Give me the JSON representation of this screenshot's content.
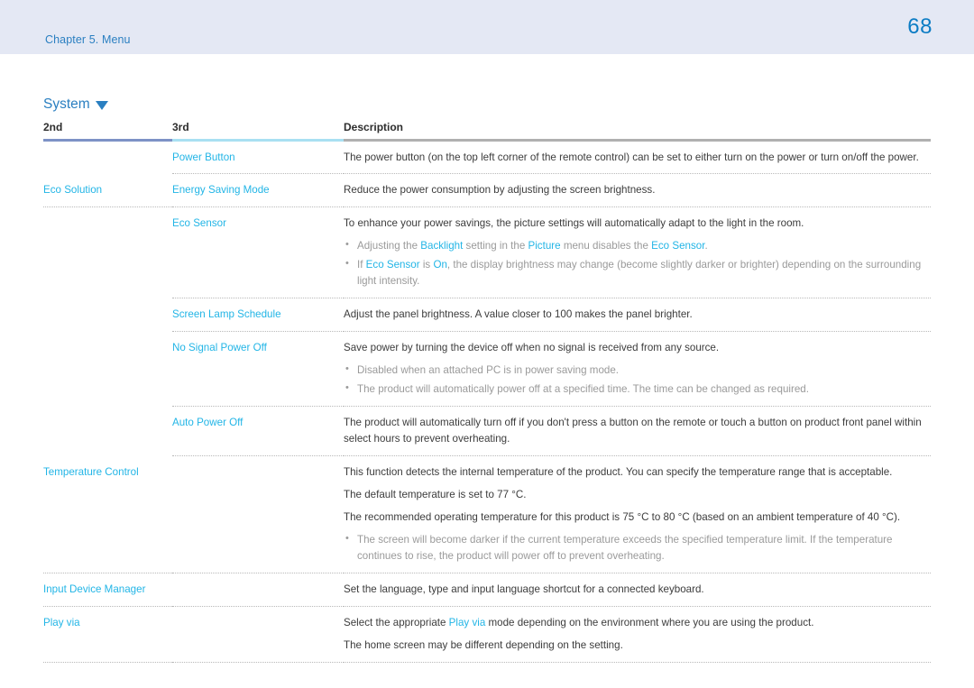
{
  "header": {
    "chapter": "Chapter 5. Menu",
    "page_number": "68",
    "band_color": "#e4e8f4",
    "chapter_color": "#2a7fc1",
    "page_number_color": "#0c7cc4"
  },
  "section": {
    "title": "System",
    "caret_icon": "caret-down-icon",
    "title_color": "#2a7fc1"
  },
  "table": {
    "columns": [
      "2nd",
      "3rd",
      "Description"
    ],
    "column_rule_colors": [
      "#7d92c6",
      "#a9e0f2",
      "#b0b0b0"
    ],
    "accent_color": "#22b5e6",
    "rows": [
      {
        "second": "",
        "third": "Power Button",
        "paragraphs": [
          "The power button (on the top left corner of the remote control) can be set to either turn on the power or turn on/off the power."
        ],
        "notes": []
      },
      {
        "second": "Eco Solution",
        "third": "Energy Saving Mode",
        "paragraphs": [
          "Reduce the power consumption by adjusting the screen brightness."
        ],
        "notes": []
      },
      {
        "second": "",
        "third": "Eco Sensor",
        "paragraphs": [
          "To enhance your power savings, the picture settings will automatically adapt to the light in the room."
        ],
        "notes": [
          {
            "segments": [
              {
                "text": "Adjusting the ",
                "accent": false
              },
              {
                "text": "Backlight",
                "accent": true
              },
              {
                "text": " setting in the ",
                "accent": false
              },
              {
                "text": "Picture",
                "accent": true
              },
              {
                "text": " menu disables the ",
                "accent": false
              },
              {
                "text": "Eco Sensor",
                "accent": true
              },
              {
                "text": ".",
                "accent": false
              }
            ]
          },
          {
            "segments": [
              {
                "text": "If ",
                "accent": false
              },
              {
                "text": "Eco Sensor",
                "accent": true
              },
              {
                "text": " is ",
                "accent": false
              },
              {
                "text": "On",
                "accent": true
              },
              {
                "text": ", the display brightness may change (become slightly darker or brighter) depending on the surrounding light intensity.",
                "accent": false
              }
            ]
          }
        ]
      },
      {
        "second": "",
        "third": "Screen Lamp Schedule",
        "paragraphs": [
          "Adjust the panel brightness. A value closer to 100 makes the panel brighter."
        ],
        "notes": []
      },
      {
        "second": "",
        "third": "No Signal Power Off",
        "paragraphs": [
          "Save power by turning the device off when no signal is received from any source."
        ],
        "notes": [
          {
            "segments": [
              {
                "text": "Disabled when an attached PC is in power saving mode.",
                "accent": false
              }
            ]
          },
          {
            "segments": [
              {
                "text": "The product will automatically power off at a specified time. The time can be changed as required.",
                "accent": false
              }
            ]
          }
        ]
      },
      {
        "second": "",
        "third": "Auto Power Off",
        "paragraphs": [
          "The product will automatically turn off if you don't press a button on the remote or touch a button on product front panel within select hours to prevent overheating."
        ],
        "notes": []
      },
      {
        "second": "Temperature Control",
        "third": "",
        "paragraphs": [
          "This function detects the internal temperature of the product. You can specify the temperature range that is acceptable.",
          "The default temperature is set to 77 °C.",
          "The recommended operating temperature for this product is 75 °C to 80 °C (based on an ambient temperature of 40 °C)."
        ],
        "notes": [
          {
            "segments": [
              {
                "text": "The screen will become darker if the current temperature exceeds the specified temperature limit. If the temperature continues to rise, the product will power off to prevent overheating.",
                "accent": false
              }
            ]
          }
        ]
      },
      {
        "second": "Input Device Manager",
        "third": "",
        "paragraphs": [
          "Set the language, type and input language shortcut for a connected keyboard."
        ],
        "notes": []
      },
      {
        "second": "Play via",
        "third": "",
        "paragraphs_rich": [
          [
            {
              "text": "Select the appropriate ",
              "accent": false
            },
            {
              "text": "Play via",
              "accent": true
            },
            {
              "text": " mode depending on the environment where you are using the product.",
              "accent": false
            }
          ],
          [
            {
              "text": "The home screen may be different depending on the setting.",
              "accent": false
            }
          ]
        ],
        "paragraphs": [],
        "notes": []
      }
    ]
  }
}
